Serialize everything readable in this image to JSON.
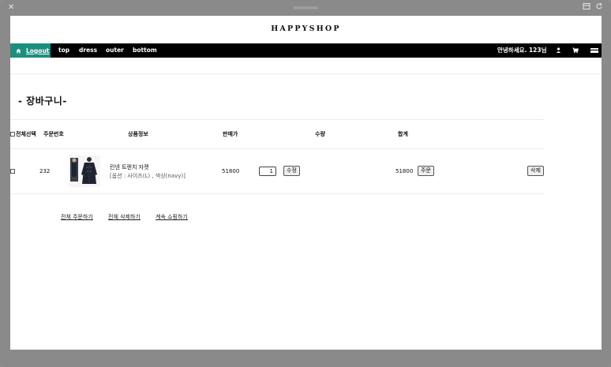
{
  "window": {
    "close_glyph": "✕",
    "icons": [
      "window-icon",
      "refresh-icon"
    ]
  },
  "logo": "HAPPYSHOP",
  "nav": {
    "logout": "Logout",
    "links": [
      "top",
      "dress",
      "outer",
      "bottom"
    ],
    "greeting": "안녕하세요. 123님",
    "icons": [
      "user-icon",
      "cart-icon",
      "card-icon"
    ]
  },
  "cart": {
    "title": "- 장바구니-",
    "headers": {
      "select_all": "전체선택",
      "order_no": "주문번호",
      "product_info": "상품정보",
      "price": "판매가",
      "quantity": "수량",
      "total": "합계"
    },
    "items": [
      {
        "order_no": "232",
        "name": "린넨 트렌치 자켓",
        "options": "[옵션 : 사이즈(L) , 색상(navy)]",
        "price": "51800",
        "quantity": "1",
        "total": "51800"
      }
    ],
    "buttons": {
      "update": "수정",
      "order": "주문",
      "delete": "삭제"
    },
    "actions": [
      "전체 주문하기",
      "전체 삭제하기",
      "계속 쇼핑하기"
    ]
  },
  "colors": {
    "nav_bg": "#000000",
    "accent": "#1d8f80"
  }
}
